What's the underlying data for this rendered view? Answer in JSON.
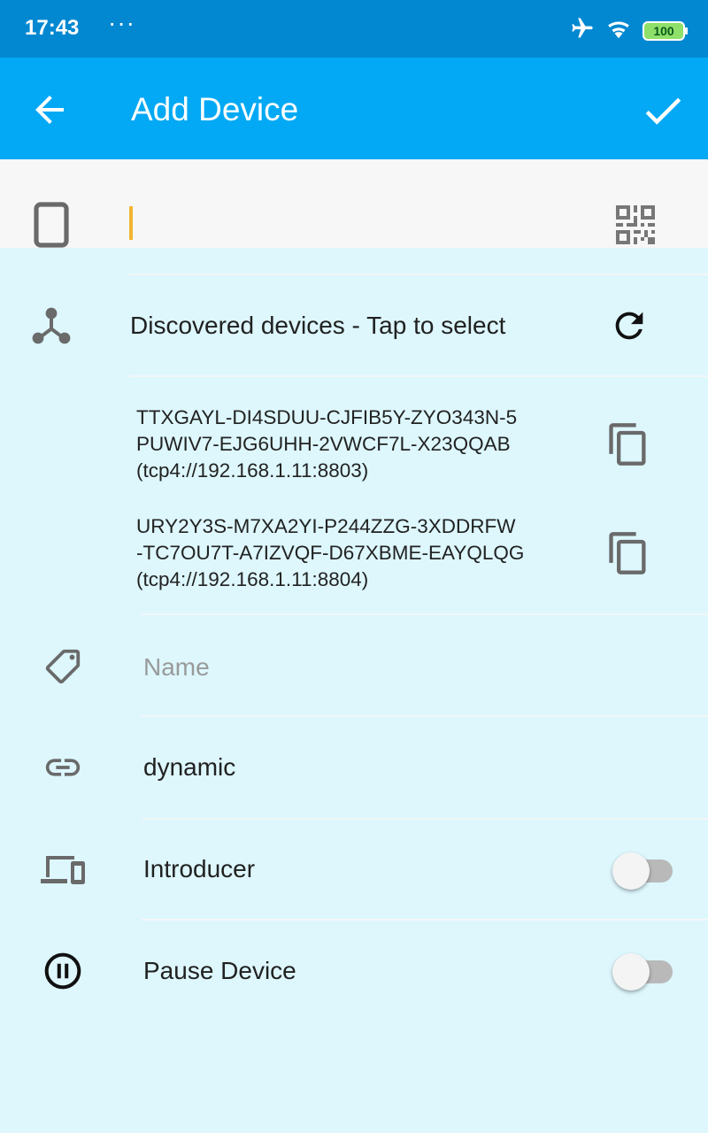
{
  "status_bar": {
    "time": "17:43",
    "dots": "···",
    "battery": "100",
    "icons": [
      "airplane-icon",
      "wifi-icon",
      "battery-icon"
    ]
  },
  "app_bar": {
    "title": "Add Device",
    "icons": [
      "back-arrow-icon",
      "check-icon"
    ]
  },
  "device_id": {
    "value": "",
    "icons": [
      "phone-icon",
      "qr-code-icon"
    ]
  },
  "discovered": {
    "label": "Discovered devices - Tap to select",
    "icons": [
      "network-icon",
      "refresh-icon"
    ],
    "devices": [
      {
        "line1": "TTXGAYL-DI4SDUU-CJFIB5Y-ZYO343N-5",
        "line2": "PUWIV7-EJG6UHH-2VWCF7L-X23QQAB",
        "line3": "(tcp4://192.168.1.11:8803)"
      },
      {
        "line1": "URY2Y3S-M7XA2YI-P244ZZG-3XDDRFW",
        "line2": "-TC7OU7T-A7IZVQF-D67XBME-EAYQLQG",
        "line3": "(tcp4://192.168.1.11:8804)"
      }
    ]
  },
  "name": {
    "placeholder": "Name",
    "value": ""
  },
  "addresses": {
    "value": "dynamic"
  },
  "introducer": {
    "label": "Introducer",
    "checked": false
  },
  "pause": {
    "label": "Pause Device",
    "checked": false
  },
  "colors": {
    "status_bar": "#0288d1",
    "app_bar": "#03a9f4",
    "background": "#ddf7fd",
    "cursor": "#f2b531"
  }
}
